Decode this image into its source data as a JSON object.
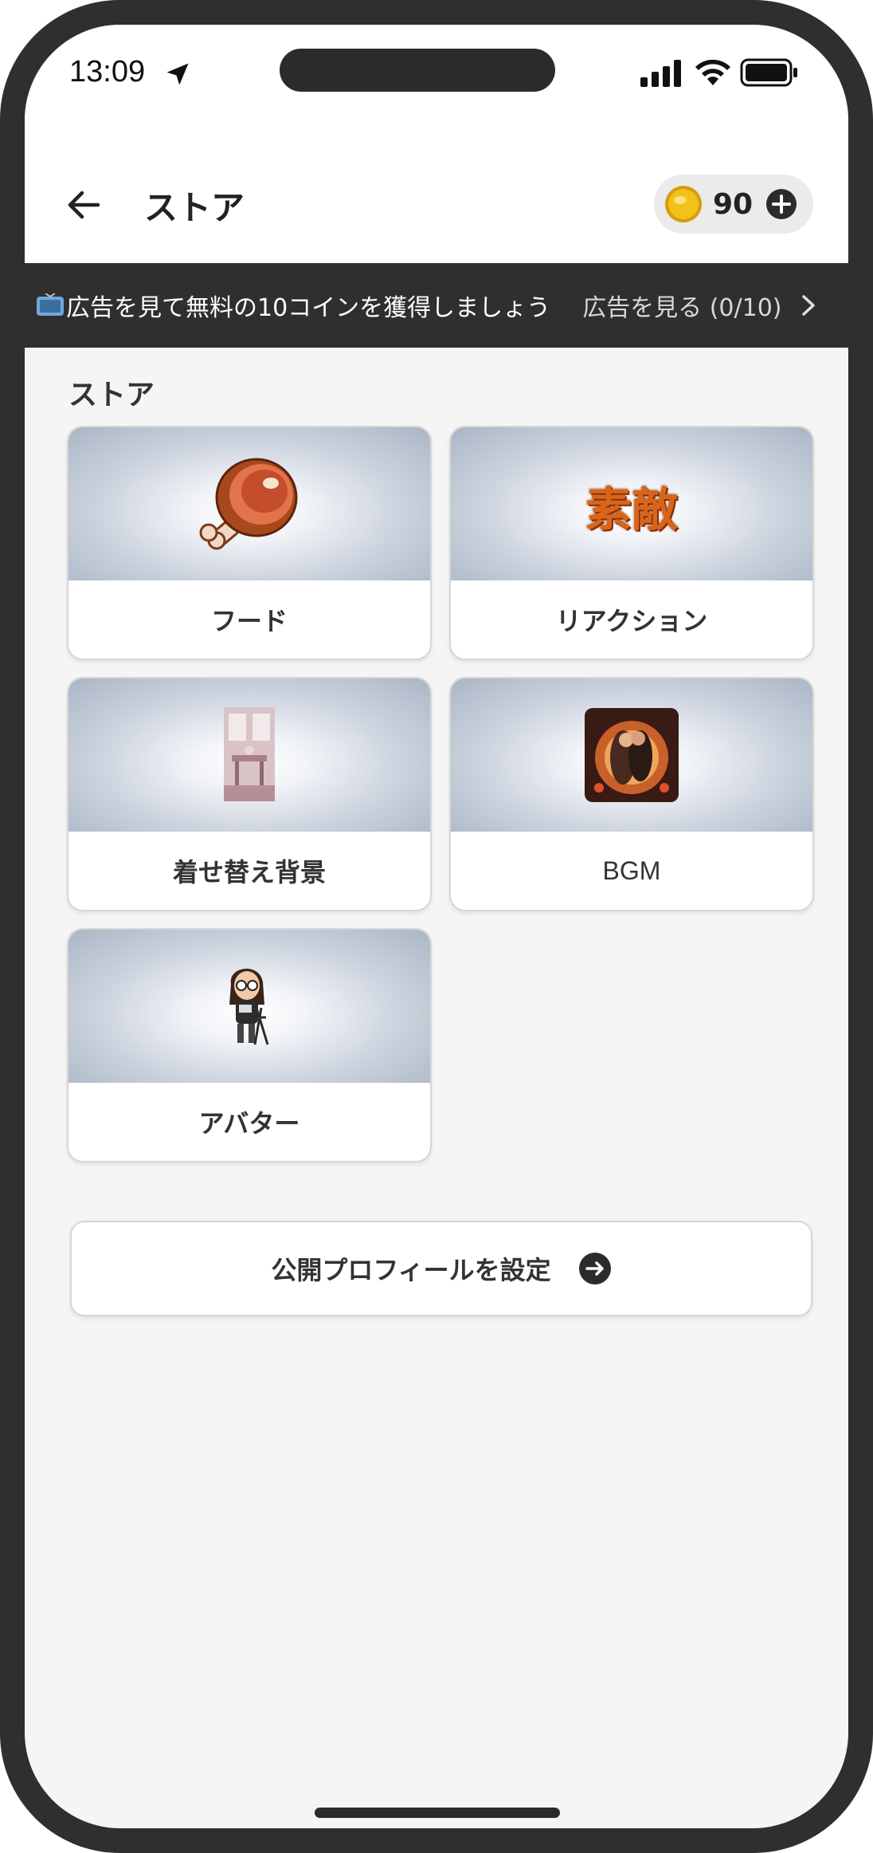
{
  "status_bar": {
    "time": "13:09"
  },
  "header": {
    "title": "ストア",
    "coin_count": "90"
  },
  "ad_banner": {
    "text": "広告を見て無料の10コインを獲得しましょう",
    "link": "広告を見る (0/10)"
  },
  "store": {
    "section_title": "ストア",
    "items": [
      {
        "label": "フード",
        "icon": "meat-icon"
      },
      {
        "label": "リアクション",
        "icon": "reaction-text-icon",
        "icon_text": "素敵"
      },
      {
        "label": "着せ替え背景",
        "icon": "room-background-icon"
      },
      {
        "label": "BGM",
        "icon": "bgm-cover-icon"
      },
      {
        "label": "アバター",
        "icon": "avatar-character-icon"
      }
    ]
  },
  "profile_button": {
    "label": "公開プロフィールを設定"
  },
  "colors": {
    "frame": "#2f2f2f",
    "banner_bg": "#2f2f2f",
    "coin": "#f2c21b",
    "card_gradient_edge": "#aab5c5"
  }
}
